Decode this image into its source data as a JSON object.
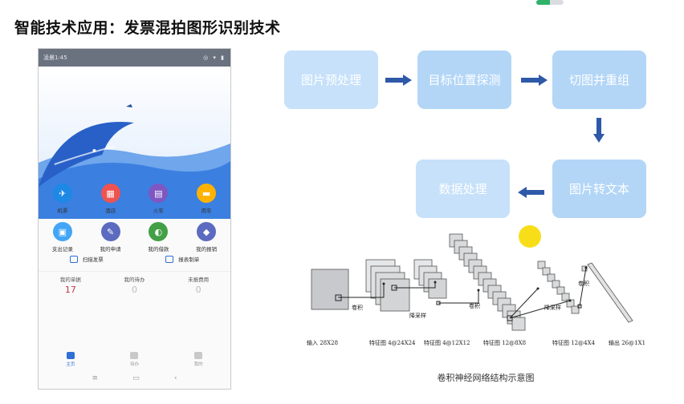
{
  "slide": {
    "title": "智能技术应用：发票混拍图形识别技术",
    "progress": 0.5
  },
  "phone": {
    "status_time": "凌晨1:45",
    "status_icons": "◎ ▾ ▮",
    "grid": [
      {
        "label": "机票",
        "icon": "plane-icon",
        "color": "#1e88e5"
      },
      {
        "label": "酒店",
        "icon": "hotel-icon",
        "color": "#ef5350"
      },
      {
        "label": "火车",
        "icon": "train-icon",
        "color": "#7e57c2"
      },
      {
        "label": "用车",
        "icon": "car-icon",
        "color": "#ffb300"
      },
      {
        "label": "支出记录",
        "icon": "record-icon",
        "color": "#42a5f5"
      },
      {
        "label": "我的申请",
        "icon": "apply-icon",
        "color": "#5c6bc0"
      },
      {
        "label": "我的借款",
        "icon": "loan-icon",
        "color": "#43a047"
      },
      {
        "label": "我的报销",
        "icon": "reimburse-icon",
        "color": "#5c6bc0"
      }
    ],
    "actions": {
      "scan": "扫描发票",
      "claim": "报表制单"
    },
    "stats": {
      "labels": [
        "我的单据",
        "我的待办",
        "未报费用"
      ],
      "values": [
        "17",
        "0",
        "0"
      ]
    },
    "tabs": [
      "主页",
      "待办",
      "我的"
    ]
  },
  "flow": {
    "step1": "图片预处理",
    "step2": "目标位置探测",
    "step3": "切图并重组",
    "step4": "图片转文本",
    "step5": "数据处理"
  },
  "cnn": {
    "labels": {
      "conv1": "卷积",
      "pool1": "降采样",
      "conv2": "卷积",
      "pool2": "降采样",
      "conv3": "卷积"
    },
    "bottom": {
      "input": "输入 28X28",
      "f1": "特征图 4@24X24",
      "f2": "特征图 4@12X12",
      "f3": "特征图 12@8X8",
      "f4": "特征图 12@4X4",
      "out": "输出 26@1X1"
    },
    "caption": "卷积神经网络结构示意图"
  },
  "colors": {
    "flow_box": "#b3d6f7",
    "arrow": "#2e59a8",
    "accent_yellow": "#f7de19"
  }
}
